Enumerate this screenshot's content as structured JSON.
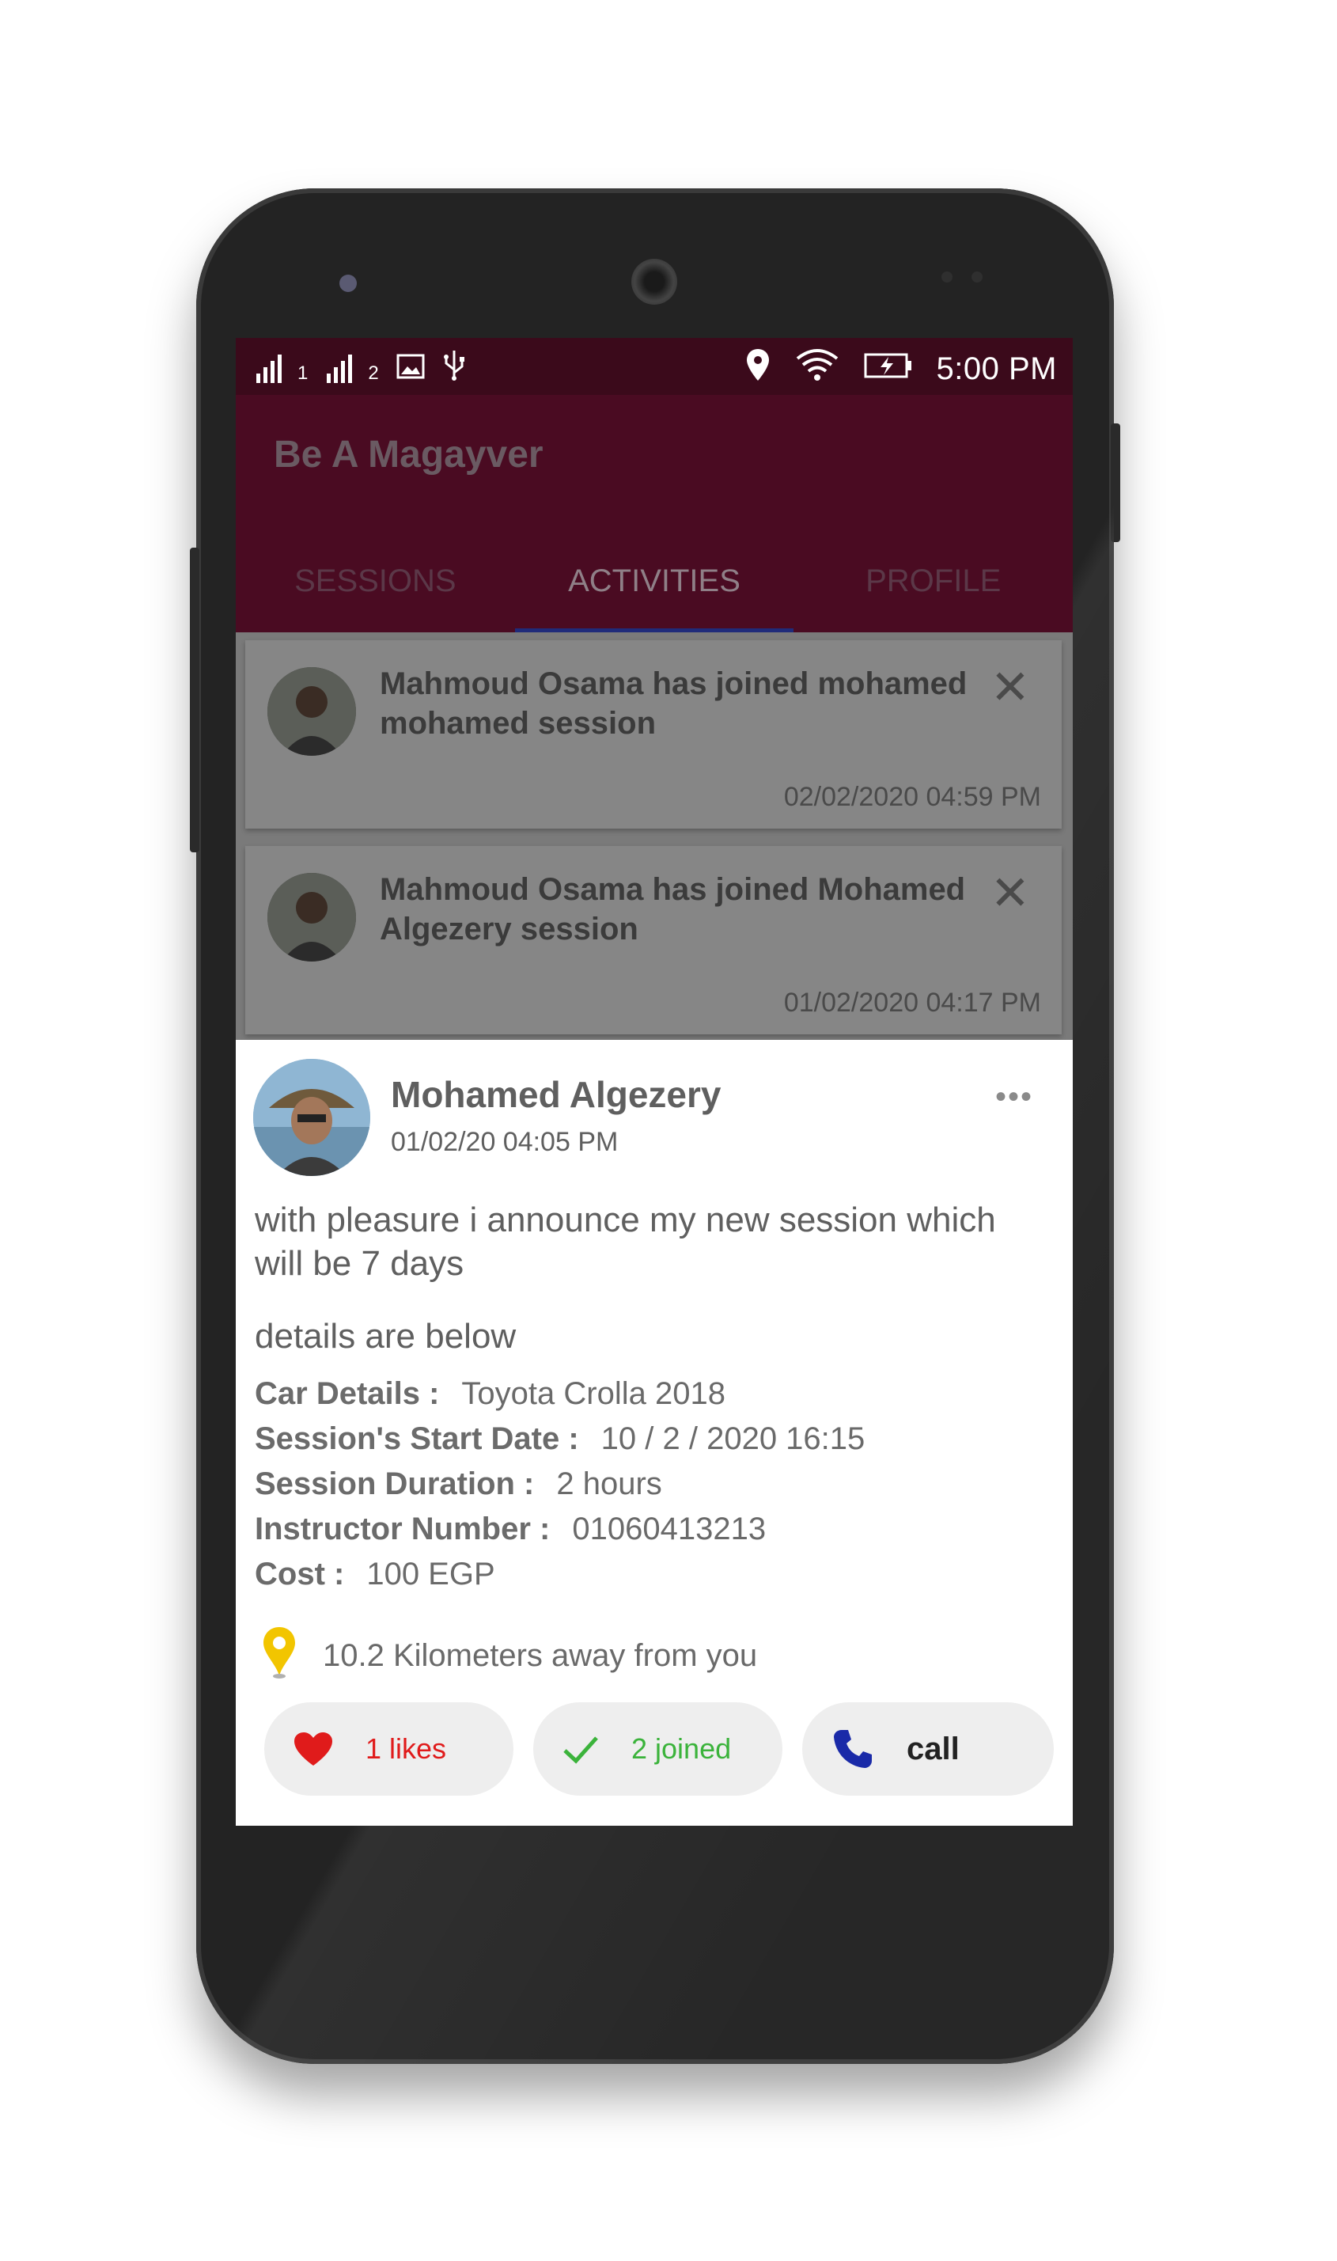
{
  "status_bar": {
    "sim1": "1",
    "sim2": "2",
    "time": "5:00 PM"
  },
  "app": {
    "title": "Be A Magayver",
    "tabs": [
      {
        "label": "SESSIONS",
        "active": false
      },
      {
        "label": "ACTIVITIES",
        "active": true
      },
      {
        "label": "PROFILE",
        "active": false
      }
    ]
  },
  "activities": [
    {
      "message": "Mahmoud Osama has joined mohamed mohamed session",
      "time": "02/02/2020 04:59 PM"
    },
    {
      "message": "Mahmoud Osama has joined Mohamed Algezery session",
      "time": "01/02/2020 04:17 PM"
    }
  ],
  "post": {
    "author": "Mohamed Algezery",
    "date": "01/02/20 04:05 PM",
    "more": "•••",
    "text": "with pleasure i announce my new session which will be 7 days",
    "details_heading": "details are below",
    "details": [
      {
        "label": "Car Details :",
        "value": "Toyota Crolla 2018"
      },
      {
        "label": "Session's Start Date :",
        "value": "10 / 2 / 2020 16:15"
      },
      {
        "label": "Session Duration :",
        "value": "2 hours"
      },
      {
        "label": "Instructor Number :",
        "value": "01060413213"
      },
      {
        "label": "Cost :",
        "value": "100 EGP"
      }
    ],
    "distance": "10.2 Kilometers away from you",
    "likes_label": "1 likes",
    "joined_label": "2 joined",
    "call_label": "call"
  },
  "colors": {
    "status_bar": "#3b0a1b",
    "app_bar": "#4a0b22",
    "tab_indicator": "#1f2b7a",
    "likes": "#e01b1b",
    "joined": "#3bb33b",
    "call_icon": "#1a2aa8",
    "pin": "#f2c500"
  }
}
